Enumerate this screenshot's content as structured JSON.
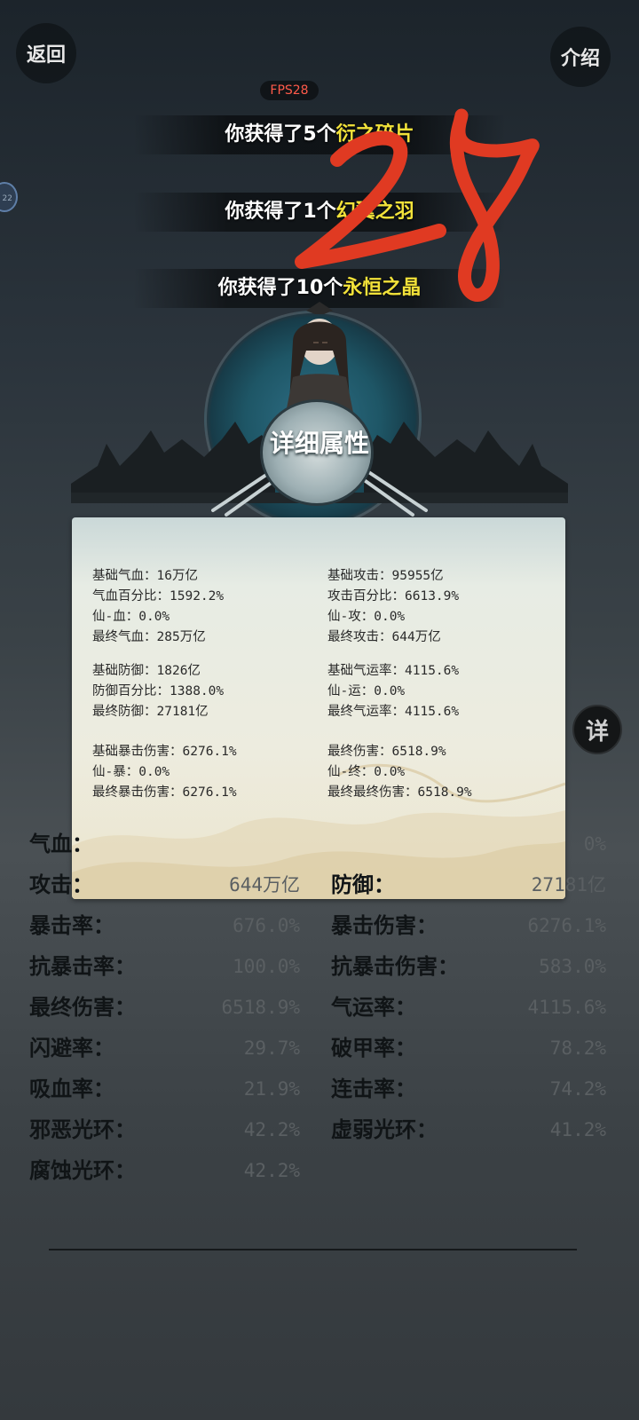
{
  "nav": {
    "back_label": "返回",
    "intro_label": "介绍"
  },
  "fps": "FPS28",
  "side_badge": "22",
  "rewards": [
    {
      "prefix": "你获得了5个",
      "item": "衍之碎片"
    },
    {
      "prefix": "你获得了1个",
      "item": "幻翼之羽"
    },
    {
      "prefix": "你获得了10个",
      "item": "永恒之晶"
    }
  ],
  "overlay_scribble": "28",
  "banner_title": "详细属性",
  "detail": {
    "left": [
      [
        "基础气血：16万亿",
        "气血百分比：1592.2%",
        "仙-血：0.0%",
        "最终气血：285万亿"
      ],
      [
        "基础防御：1826亿",
        "防御百分比：1388.0%",
        "最终防御：27181亿"
      ],
      [
        "基础暴击伤害：6276.1%",
        "仙-暴：0.0%",
        "最终暴击伤害：6276.1%"
      ]
    ],
    "right": [
      [
        "基础攻击：95955亿",
        "攻击百分比：6613.9%",
        "仙-攻：0.0%",
        "最终攻击：644万亿"
      ],
      [
        "基础气运率：4115.6%",
        "仙-运：0.0%",
        "最终气运率：4115.6%"
      ],
      [
        "最终伤害：6518.9%",
        "仙-终：0.0%",
        "最终最终伤害：6518.9%"
      ]
    ]
  },
  "detail_button": "详",
  "stats": [
    [
      {
        "label": "气血：",
        "value": ""
      },
      {
        "label": "",
        "value": "0%"
      }
    ],
    [
      {
        "label": "攻击：",
        "value": "644万亿"
      },
      {
        "label": "防御：",
        "value": "27181亿"
      }
    ],
    [
      {
        "label": "暴击率：",
        "value": "676.0%"
      },
      {
        "label": "暴击伤害：",
        "value": "6276.1%"
      }
    ],
    [
      {
        "label": "抗暴击率：",
        "value": "100.0%"
      },
      {
        "label": "抗暴击伤害：",
        "value": "583.0%"
      }
    ],
    [
      {
        "label": "最终伤害：",
        "value": "6518.9%"
      },
      {
        "label": "气运率：",
        "value": "4115.6%"
      }
    ],
    [
      {
        "label": "闪避率：",
        "value": "29.7%"
      },
      {
        "label": "破甲率：",
        "value": "78.2%"
      }
    ],
    [
      {
        "label": "吸血率：",
        "value": "21.9%"
      },
      {
        "label": "连击率：",
        "value": "74.2%"
      }
    ],
    [
      {
        "label": "邪恶光环：",
        "value": "42.2%"
      },
      {
        "label": "虚弱光环：",
        "value": "41.2%"
      }
    ],
    [
      {
        "label": "腐蚀光环：",
        "value": "42.2%"
      }
    ]
  ],
  "colors": {
    "reward_item": "#f2e23a",
    "fps": "#ff5a4a",
    "scribble": "#e03a22"
  }
}
